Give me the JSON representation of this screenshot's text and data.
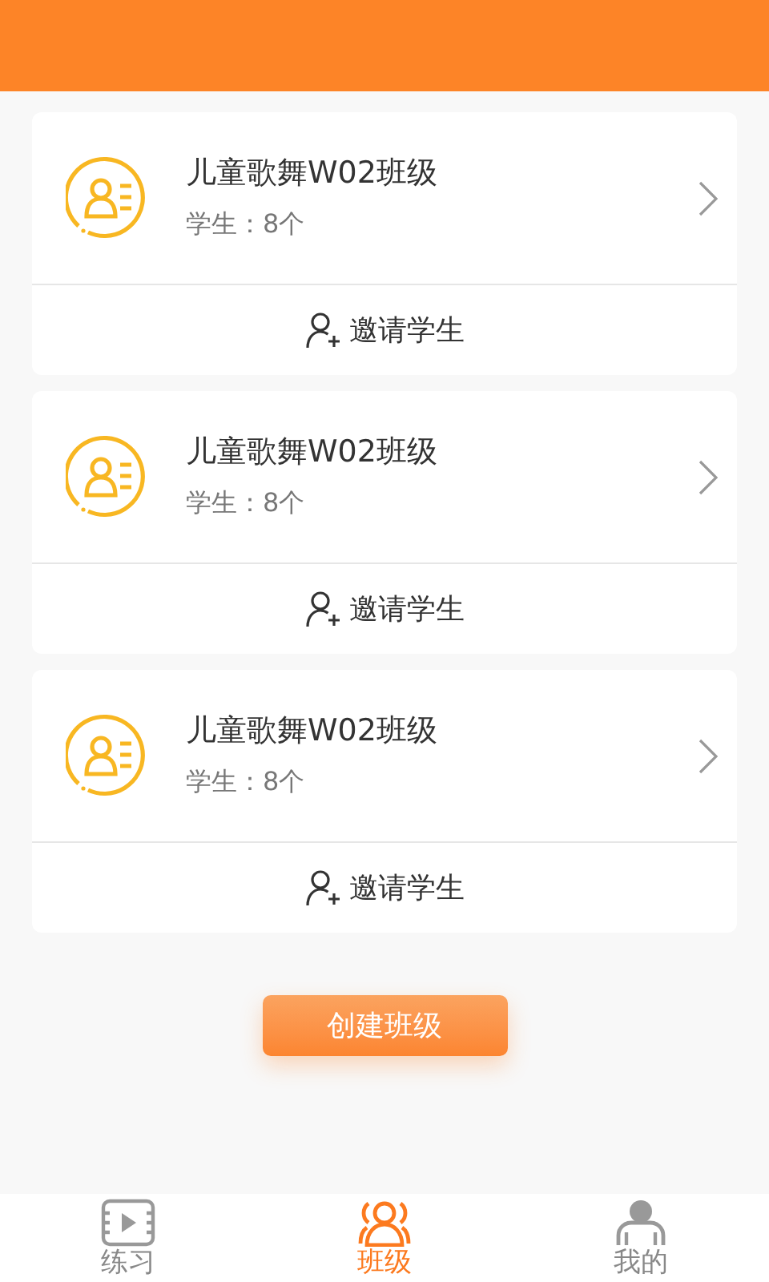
{
  "classes": [
    {
      "name": "儿童歌舞W02班级",
      "students": "学生：8个",
      "invite": "邀请学生"
    },
    {
      "name": "儿童歌舞W02班级",
      "students": "学生：8个",
      "invite": "邀请学生"
    },
    {
      "name": "儿童歌舞W02班级",
      "students": "学生：8个",
      "invite": "邀请学生"
    }
  ],
  "create_button": "创建班级",
  "tabs": [
    {
      "kind": "practice",
      "label": "练习",
      "selected": false
    },
    {
      "kind": "class",
      "label": "班级",
      "selected": true
    },
    {
      "kind": "me",
      "label": "我的",
      "selected": false
    }
  ]
}
